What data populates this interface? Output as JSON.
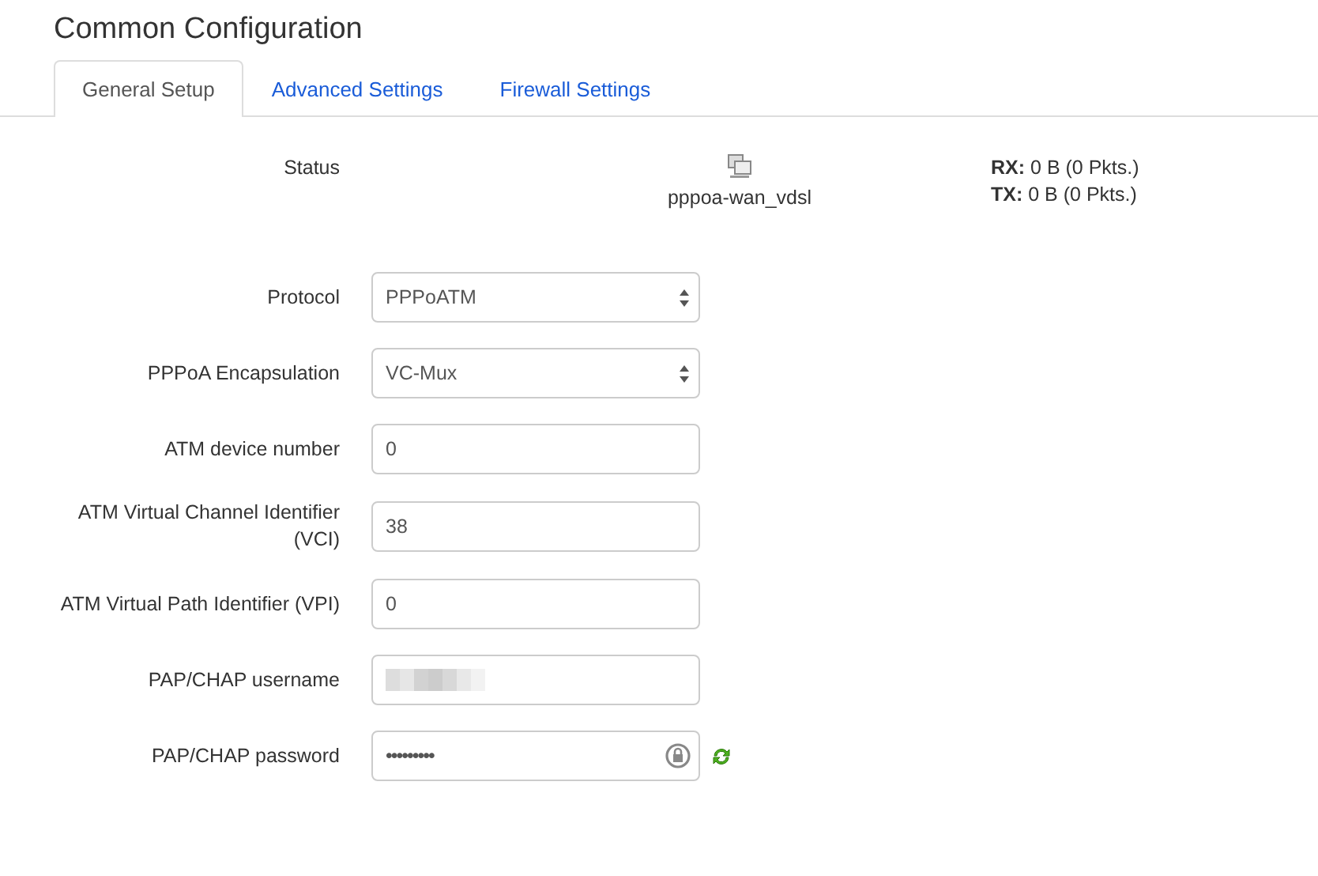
{
  "title": "Common Configuration",
  "tabs": [
    {
      "label": "General Setup",
      "selected": true
    },
    {
      "label": "Advanced Settings",
      "selected": false
    },
    {
      "label": "Firewall Settings",
      "selected": false
    }
  ],
  "status": {
    "label": "Status",
    "interface": "pppoa-wan_vdsl",
    "rx_label": "RX:",
    "rx_value": "0 B (0 Pkts.)",
    "tx_label": "TX:",
    "tx_value": "0 B (0 Pkts.)"
  },
  "fields": [
    {
      "kind": "select",
      "label": "Protocol",
      "value": "PPPoATM"
    },
    {
      "kind": "select",
      "label": "PPPoA Encapsulation",
      "value": "VC-Mux"
    },
    {
      "kind": "text",
      "label": "ATM device number",
      "value": "0"
    },
    {
      "kind": "text",
      "label": "ATM Virtual Channel Identifier (VCI)",
      "value": "38"
    },
    {
      "kind": "text",
      "label": "ATM Virtual Path Identifier (VPI)",
      "value": "0"
    },
    {
      "kind": "redacted",
      "label": "PAP/CHAP username"
    },
    {
      "kind": "password",
      "label": "PAP/CHAP password",
      "value": "•••••••••"
    }
  ]
}
